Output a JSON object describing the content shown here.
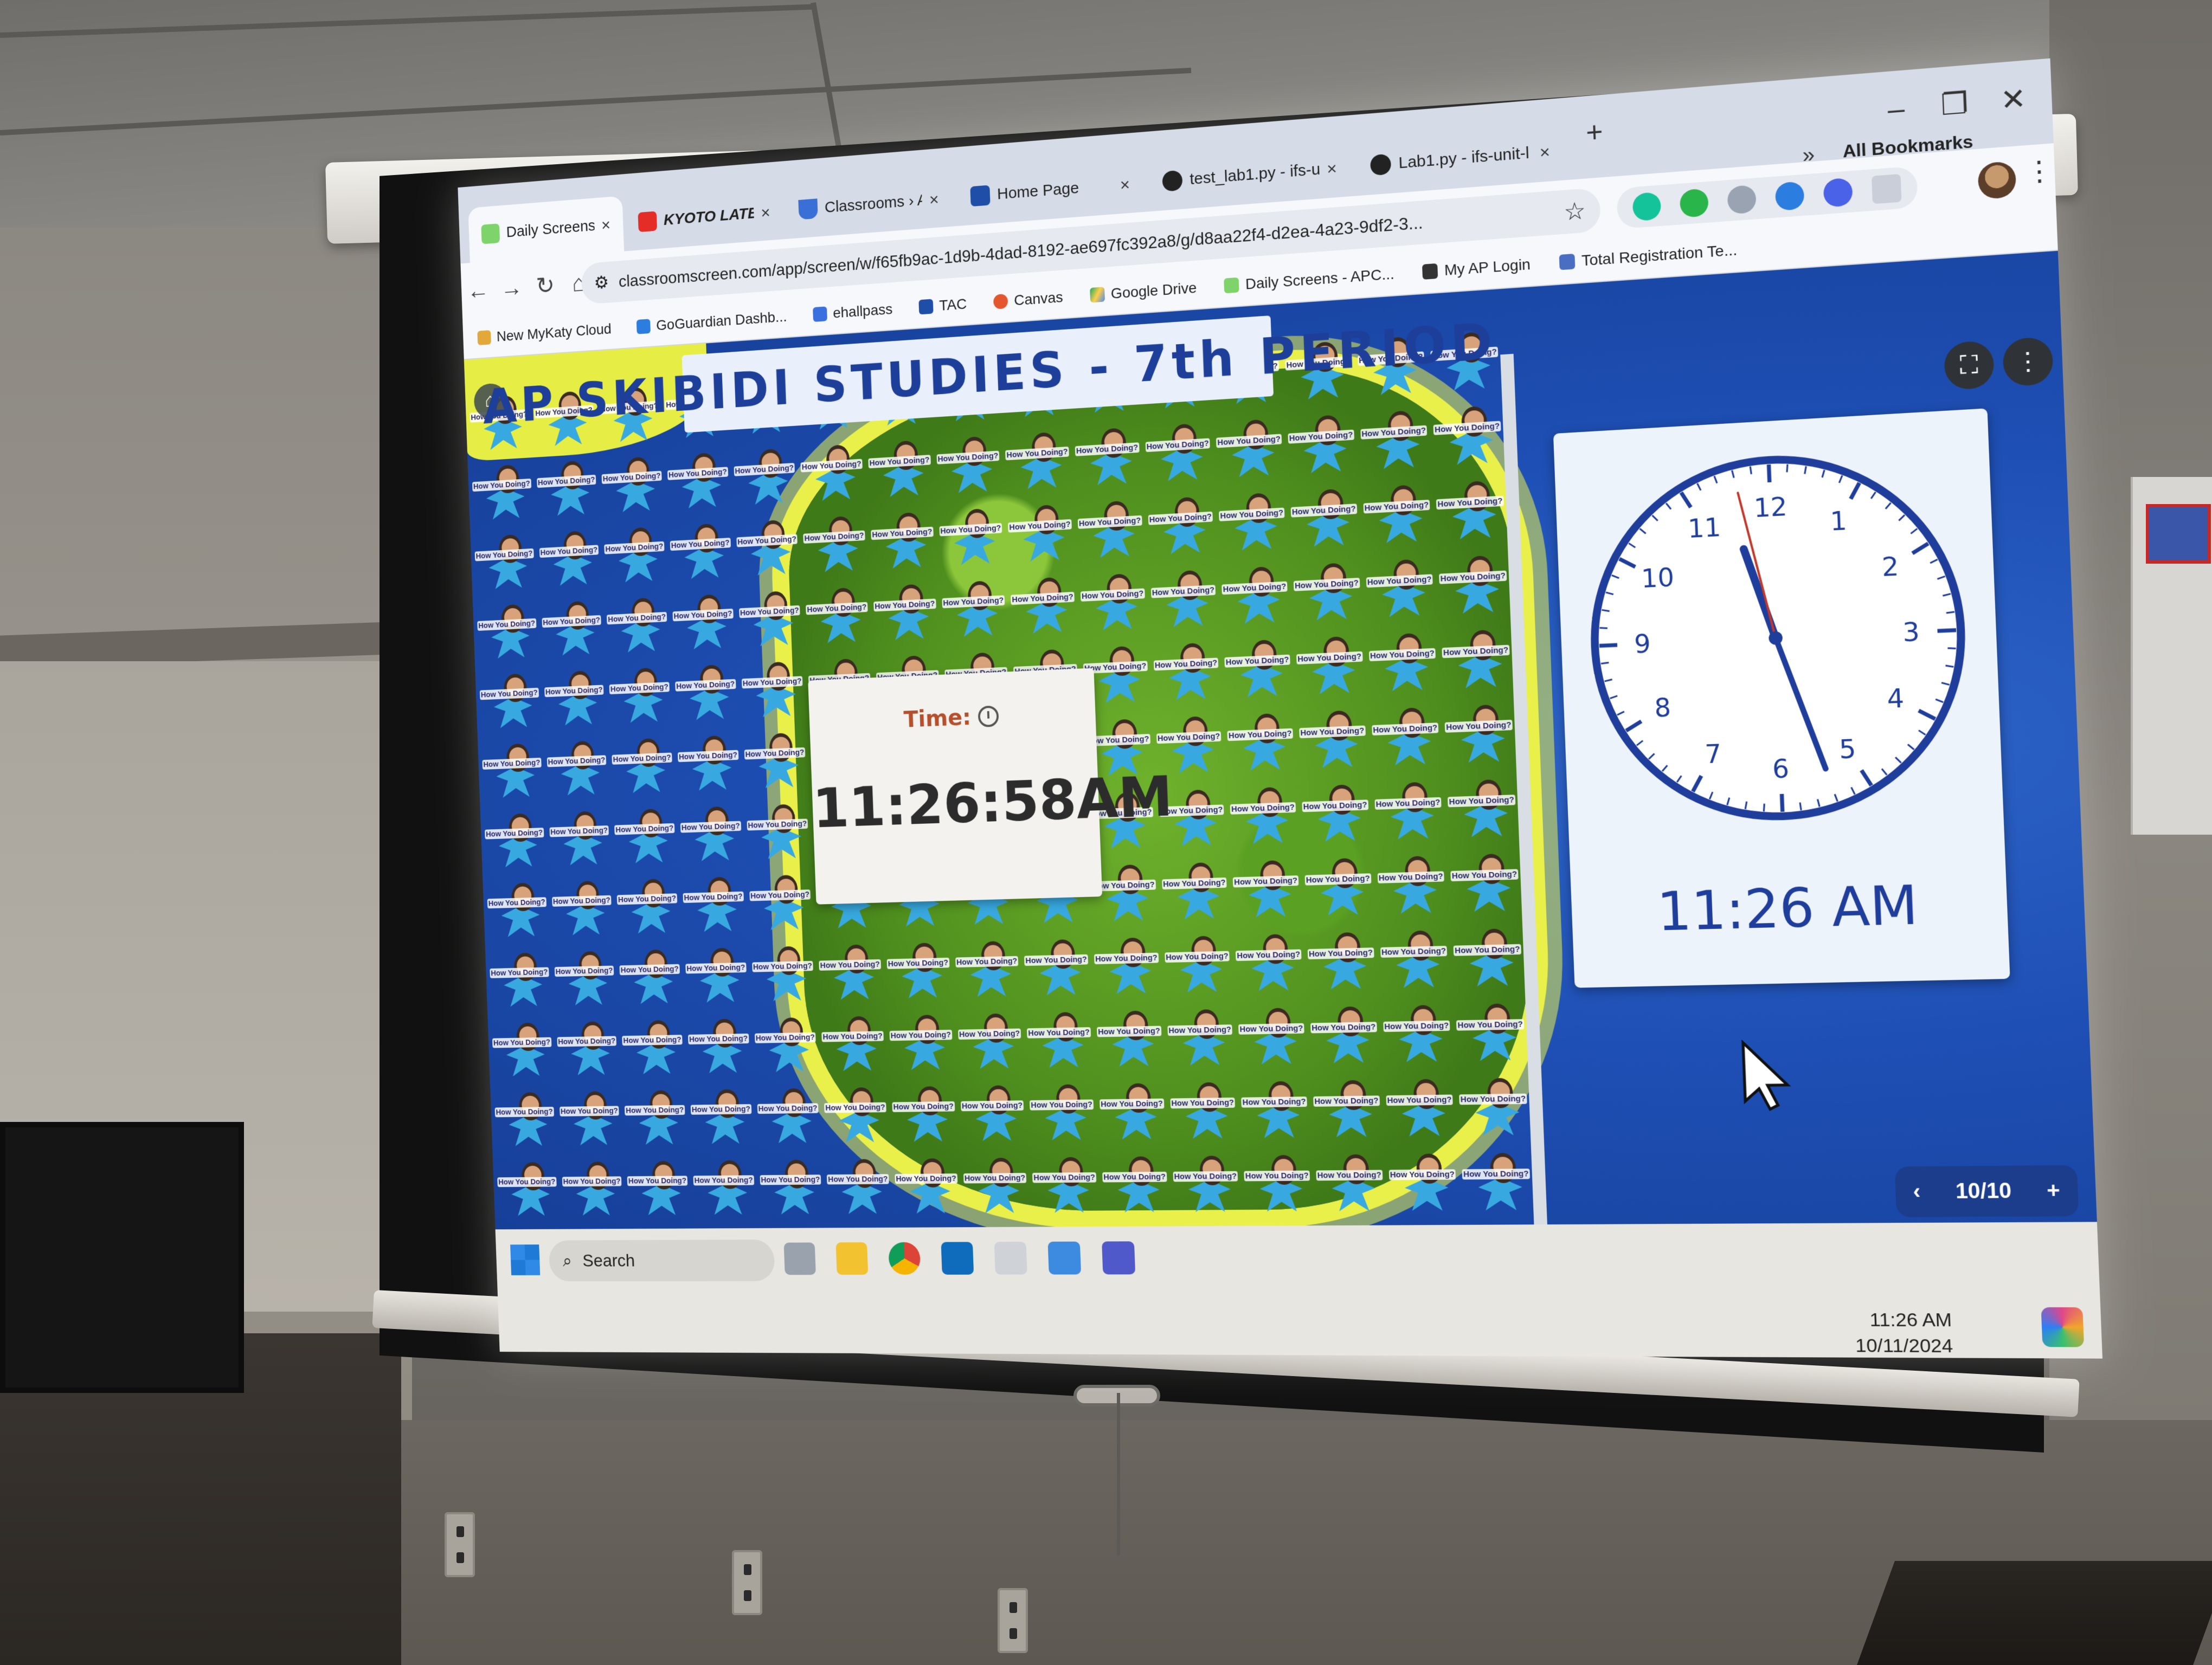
{
  "browser": {
    "tabs": [
      {
        "label": "Daily Screens - Ne",
        "icon": "classroomscreen-icon",
        "active": true
      },
      {
        "label": "KYOTO LATE NIGI",
        "icon": "youtube-icon",
        "active": false
      },
      {
        "label": "Classrooms › Activ",
        "icon": "shield-icon",
        "active": false
      },
      {
        "label": "Home Page",
        "icon": "tac-icon",
        "active": false
      },
      {
        "label": "test_lab1.py - ifs-u",
        "icon": "github-icon",
        "active": false
      },
      {
        "label": "Lab1.py - ifs-unit-l",
        "icon": "github-icon",
        "active": false
      }
    ],
    "new_tab": "+",
    "address": "classroomscreen.com/app/screen/w/f65fb9ac-1d9b-4dad-8192-ae697fc392a8/g/d8aa22f4-d2ea-4a23-9df2-3...",
    "all_bookmarks": "All Bookmarks",
    "bookmarks_more": "»",
    "bookmarks": [
      "New MyKaty Cloud",
      "GoGuardian Dashb...",
      "ehallpass",
      "TAC",
      "Canvas",
      "Google Drive",
      "Daily Screens - APC...",
      "My AP Login",
      "Total Registration Te..."
    ]
  },
  "page": {
    "title": "AP  SKIBIDI  STUDIES  -  7th  PERIOD",
    "sticker_text": "How You Doing?",
    "time_widget": {
      "label": "Time:",
      "value": "11:26:58AM"
    },
    "clock_widget": {
      "digital": "11:26 AM",
      "numbers": [
        "12",
        "1",
        "2",
        "3",
        "4",
        "5",
        "6",
        "7",
        "8",
        "9",
        "10",
        "11"
      ],
      "hour": 11,
      "minute": 26,
      "second": 58,
      "face_color": "#1f3d9a",
      "second_hand_color": "#c0392b"
    },
    "pager": {
      "prev": "‹",
      "value": "10/10",
      "add": "+"
    }
  },
  "taskbar": {
    "search_label": "Search",
    "tray_time": "11:26 AM",
    "tray_date": "10/11/2024"
  }
}
